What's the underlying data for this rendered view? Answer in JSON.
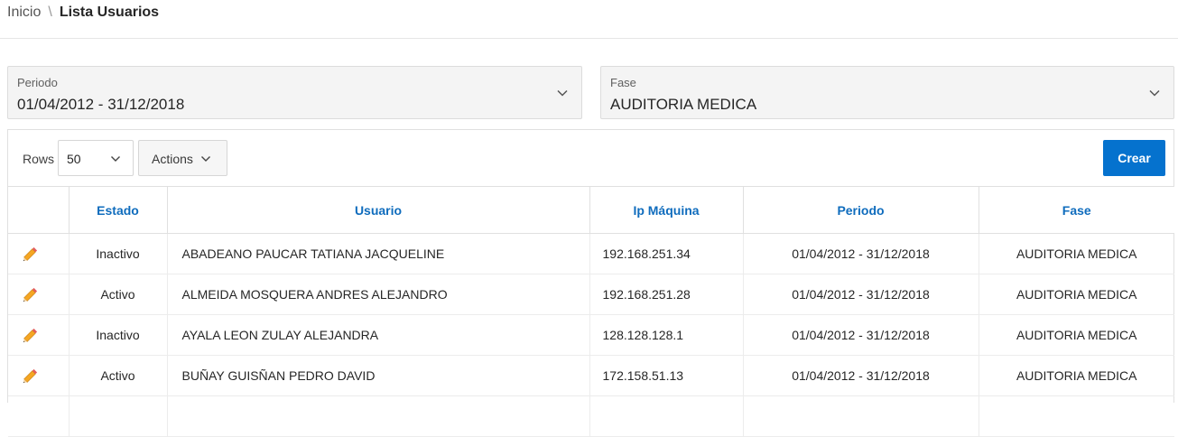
{
  "breadcrumb": {
    "home": "Inicio",
    "separator": "\\",
    "current": "Lista Usuarios"
  },
  "filters": {
    "periodo": {
      "label": "Periodo",
      "value": "01/04/2012 - 31/12/2018"
    },
    "fase": {
      "label": "Fase",
      "value": "AUDITORIA MEDICA"
    }
  },
  "toolbar": {
    "rows_label": "Rows",
    "rows_value": "50",
    "actions_label": "Actions",
    "create_label": "Crear"
  },
  "table": {
    "headers": {
      "estado": "Estado",
      "usuario": "Usuario",
      "ip": "Ip Máquina",
      "periodo": "Periodo",
      "fase": "Fase"
    },
    "rows": [
      {
        "estado": "Inactivo",
        "usuario": "ABADEANO PAUCAR TATIANA JACQUELINE",
        "ip": "192.168.251.34",
        "periodo": "01/04/2012 - 31/12/2018",
        "fase": "AUDITORIA MEDICA"
      },
      {
        "estado": "Activo",
        "usuario": "ALMEIDA MOSQUERA ANDRES ALEJANDRO",
        "ip": "192.168.251.28",
        "periodo": "01/04/2012 - 31/12/2018",
        "fase": "AUDITORIA MEDICA"
      },
      {
        "estado": "Inactivo",
        "usuario": "AYALA LEON ZULAY ALEJANDRA",
        "ip": "128.128.128.1",
        "periodo": "01/04/2012 - 31/12/2018",
        "fase": "AUDITORIA MEDICA"
      },
      {
        "estado": "Activo",
        "usuario": "BUÑAY GUISÑAN PEDRO DAVID",
        "ip": "172.158.51.13",
        "periodo": "01/04/2012 - 31/12/2018",
        "fase": "AUDITORIA MEDICA"
      },
      {
        "estado": "",
        "usuario": "",
        "ip": "",
        "periodo": "",
        "fase": ""
      }
    ]
  },
  "icons": {
    "edit": "pencil-icon",
    "select": "chevron-down-icon"
  },
  "colors": {
    "primary": "#0572ce",
    "header_text": "#0f6cbd"
  }
}
